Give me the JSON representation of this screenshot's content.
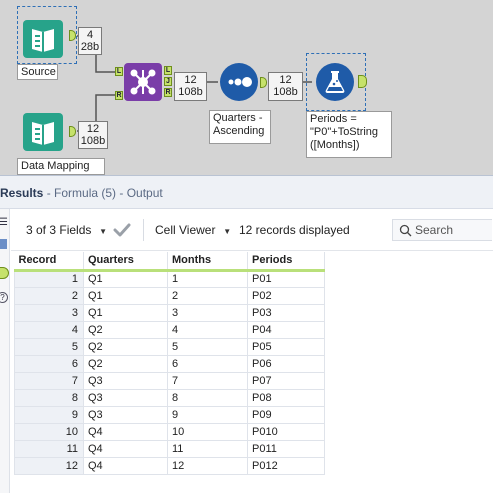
{
  "canvas": {
    "source": {
      "label": "Source",
      "count_records": "4",
      "count_bytes": "28b"
    },
    "join": {
      "anchor_left": "L",
      "anchor_right": "R",
      "anchor_out_j": "J",
      "anchor_out_l": "L",
      "anchor_out_r": "R",
      "count_records": "12",
      "count_bytes": "108b"
    },
    "data_mapping": {
      "label": "Data Mapping",
      "count_records": "12",
      "count_bytes": "108b"
    },
    "sort": {
      "label_line1": "Quarters -",
      "label_line2": "Ascending",
      "count_records": "12",
      "count_bytes": "108b"
    },
    "formula": {
      "label_line1": "Periods =",
      "label_line2": "\"P0\"+ToString",
      "label_line3": "([Months])"
    }
  },
  "results": {
    "title": "Results",
    "subtitle": "- Formula (5) - Output",
    "toolbar": {
      "fields_label": "3 of 3 Fields",
      "cell_viewer_label": "Cell Viewer",
      "records_label": "12 records displayed",
      "search_placeholder": "Search"
    },
    "columns": [
      "Record",
      "Quarters",
      "Months",
      "Periods"
    ],
    "rows": [
      [
        "1",
        "Q1",
        "1",
        "P01"
      ],
      [
        "2",
        "Q1",
        "2",
        "P02"
      ],
      [
        "3",
        "Q1",
        "3",
        "P03"
      ],
      [
        "4",
        "Q2",
        "4",
        "P04"
      ],
      [
        "5",
        "Q2",
        "5",
        "P05"
      ],
      [
        "6",
        "Q2",
        "6",
        "P06"
      ],
      [
        "7",
        "Q3",
        "7",
        "P07"
      ],
      [
        "8",
        "Q3",
        "8",
        "P08"
      ],
      [
        "9",
        "Q3",
        "9",
        "P09"
      ],
      [
        "10",
        "Q4",
        "10",
        "P010"
      ],
      [
        "11",
        "Q4",
        "11",
        "P011"
      ],
      [
        "12",
        "Q4",
        "12",
        "P012"
      ]
    ]
  },
  "colors": {
    "canvas_bg": "#d4d4d4",
    "input_tool": "#27a38a",
    "join_tool": "#7a3da8",
    "sort_tool": "#1f5ba8",
    "formula_tool": "#1f5ba8",
    "anchor": "#c6e26b",
    "header_underline": "#b9e07a"
  },
  "icons": {
    "input": "book-icon",
    "join": "join-nodes-icon",
    "sort": "sort-dots-icon",
    "formula": "flask-icon",
    "run": "checkmark-icon",
    "search": "search-icon"
  }
}
